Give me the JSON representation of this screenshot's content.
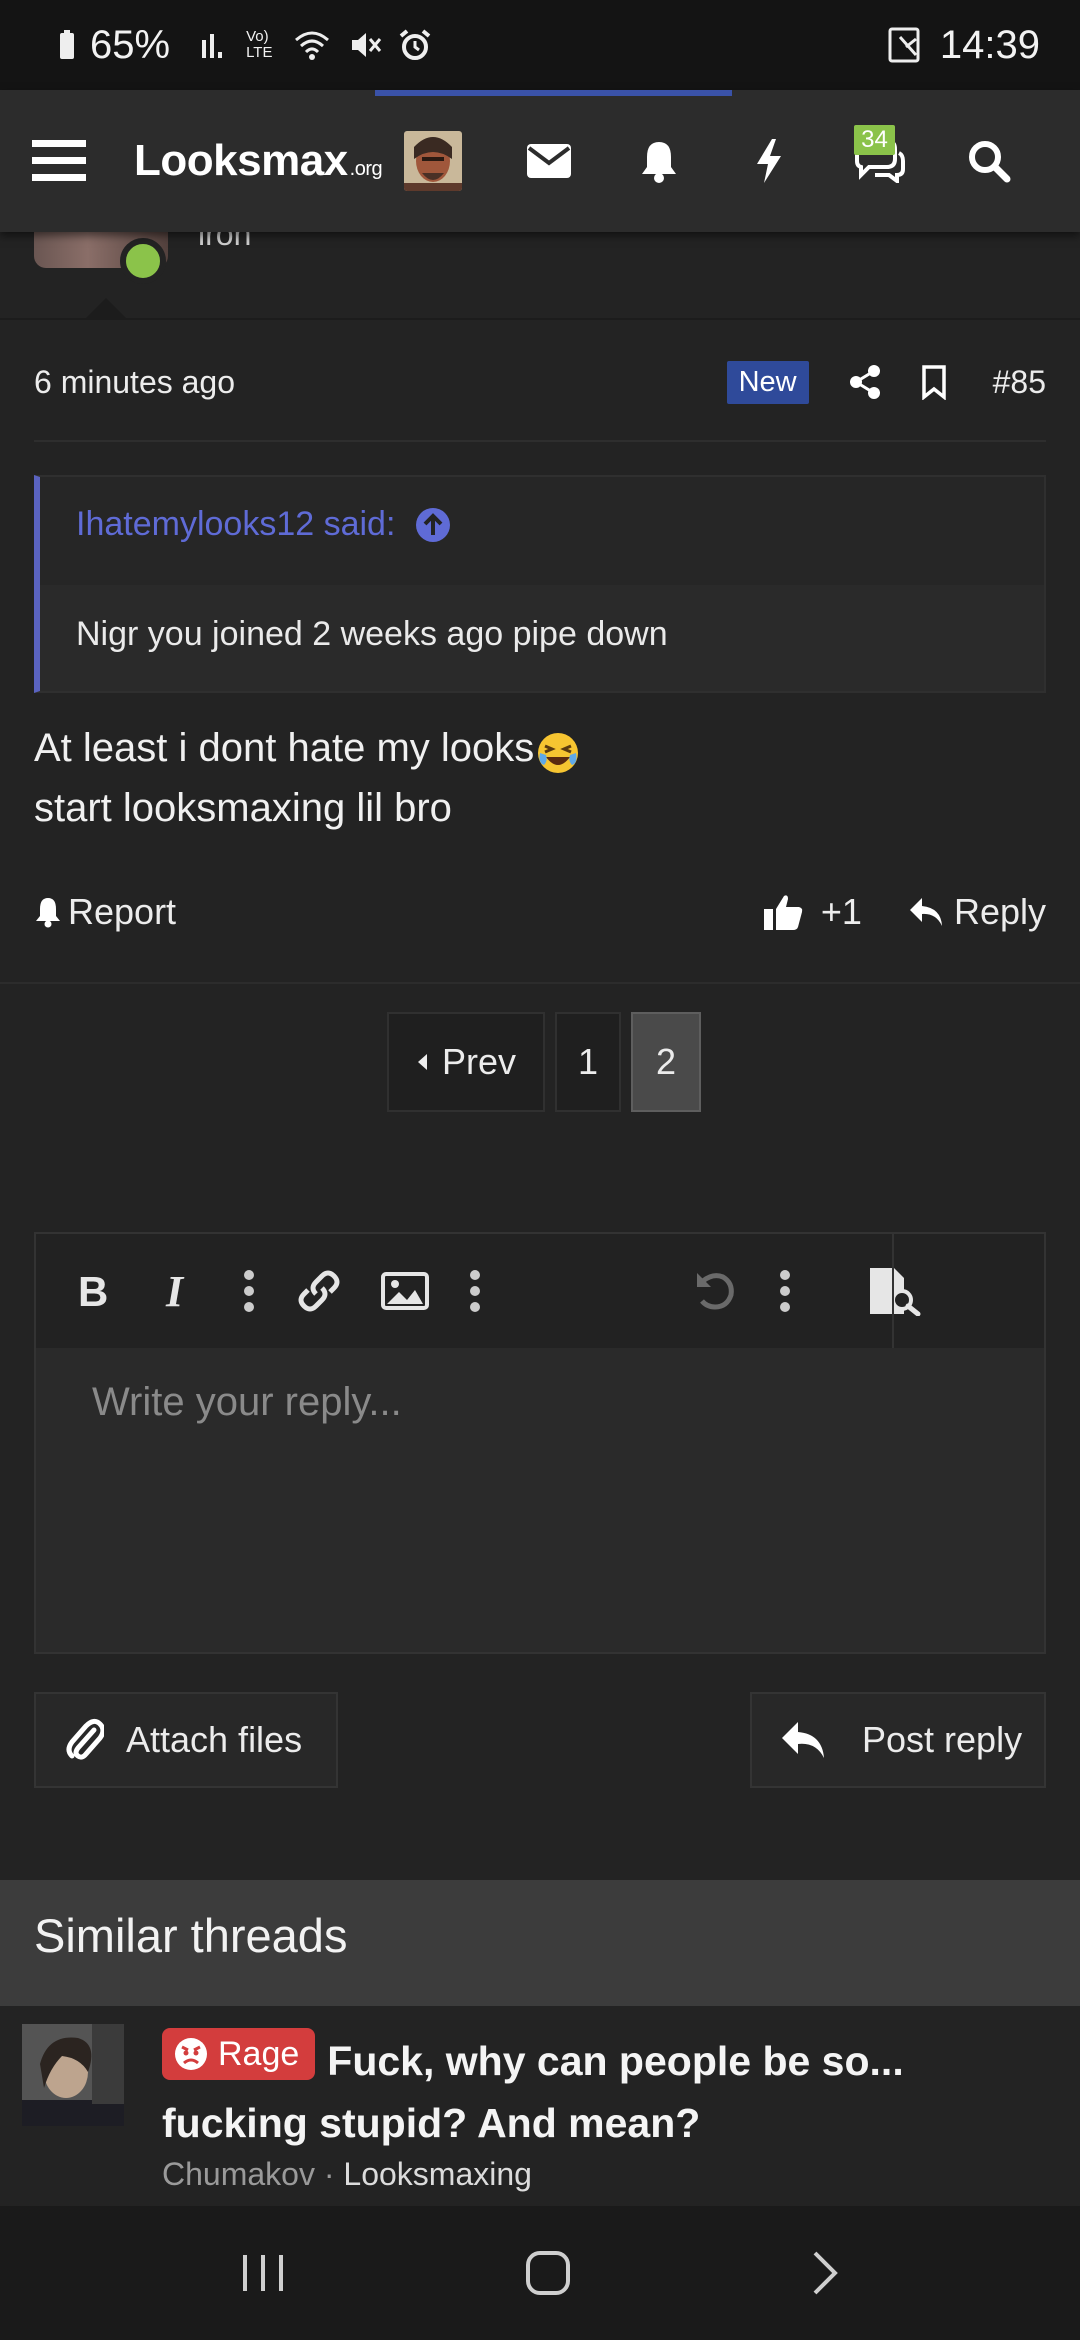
{
  "status_bar": {
    "battery": "65%",
    "time": "14:39",
    "network_label": "Vo) LTE"
  },
  "header": {
    "logo_main": "Looksmax",
    "logo_suffix": ".org",
    "conversations_badge": "34"
  },
  "post": {
    "username_partial": "iron",
    "time_ago": "6 minutes ago",
    "new_label": "New",
    "post_number": "#85",
    "quote": {
      "author_label": "Ihatemylooks12 said:",
      "text": "Nigr you joined 2 weeks ago pipe down"
    },
    "message_line1": "At least i dont hate my looks",
    "message_line2": "start looksmaxing lil bro",
    "report_label": "Report",
    "like_count": "+1",
    "reply_label": "Reply"
  },
  "pagination": {
    "prev_label": "Prev",
    "pages": [
      "1",
      "2"
    ],
    "current": "2"
  },
  "editor": {
    "placeholder": "Write your reply..."
  },
  "form": {
    "attach_label": "Attach files",
    "post_reply_label": "Post reply"
  },
  "similar_threads": {
    "heading": "Similar threads",
    "items": [
      {
        "prefix": "Rage",
        "title": "Fuck, why can people be so... fucking stupid? And mean?",
        "author": "Chumakov",
        "separator": " · ",
        "forum": "Looksmaxing"
      }
    ]
  },
  "colors": {
    "accent_blue": "#2f4a9a",
    "quote_blue": "#5f6bd6",
    "online_green": "#8bc34a",
    "rage_red": "#d33d3d"
  }
}
